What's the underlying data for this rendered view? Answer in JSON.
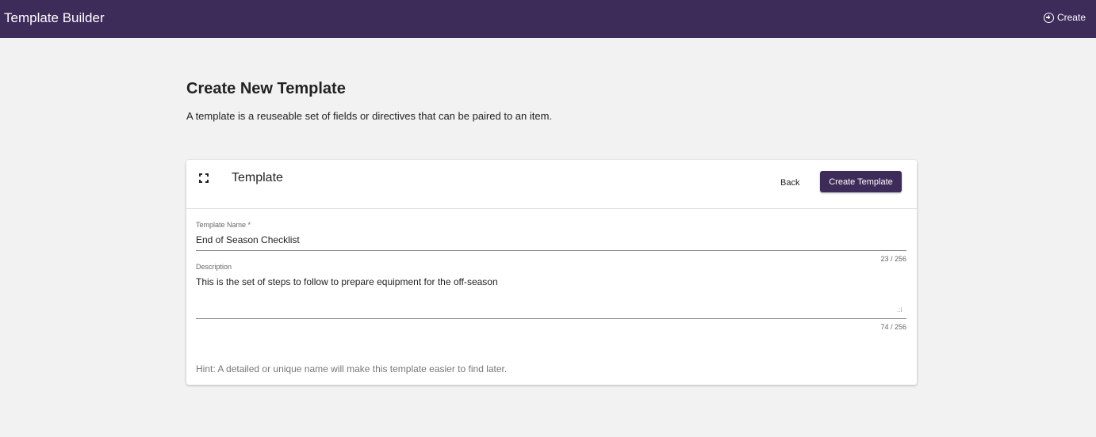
{
  "app": {
    "title": "Template Builder",
    "create_label": "Create"
  },
  "page": {
    "heading": "Create New Template",
    "description": "A template is a reuseable set of fields or directives that can be paired to an item."
  },
  "card": {
    "title": "Template",
    "back_label": "Back",
    "create_template_label": "Create Template",
    "fields": {
      "name": {
        "label": "Template Name *",
        "value": "End of Season Checklist",
        "counter": "23 / 256"
      },
      "description": {
        "label": "Description",
        "value": "This is the set of steps to follow to prepare equipment for the off-season",
        "counter": "74 / 256"
      }
    },
    "hint": "Hint: A detailed or unique name will make this template easier to find later."
  },
  "colors": {
    "brand": "#3d2b5a",
    "background": "#f2f2f2"
  }
}
